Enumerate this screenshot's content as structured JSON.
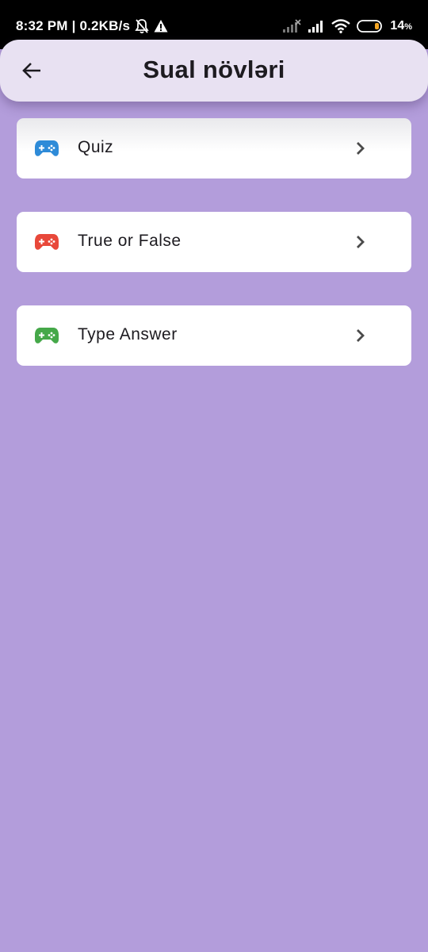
{
  "status_bar": {
    "time_speed": "8:32 PM | 0.2KB/s",
    "battery_level": "14",
    "battery_unit": "%",
    "icons": [
      "mute-bell-icon",
      "warning-icon",
      "signal-icon",
      "signal-icon",
      "wifi-icon",
      "battery-icon"
    ]
  },
  "app_bar": {
    "title": "Sual növləri",
    "back_icon": "arrow-back-icon"
  },
  "items": [
    {
      "label": "Quiz",
      "icon": "gamepad-icon",
      "icon_color": "#2e8bd8"
    },
    {
      "label": "True or False",
      "icon": "gamepad-icon",
      "icon_color": "#e8483a"
    },
    {
      "label": "Type Answer",
      "icon": "gamepad-icon",
      "icon_color": "#45a849"
    }
  ],
  "colors": {
    "background": "#b39ddb",
    "app_bar": "#e8e1f2",
    "card": "#ffffff",
    "text": "#1d1b20",
    "chevron": "#4a4a4a"
  }
}
